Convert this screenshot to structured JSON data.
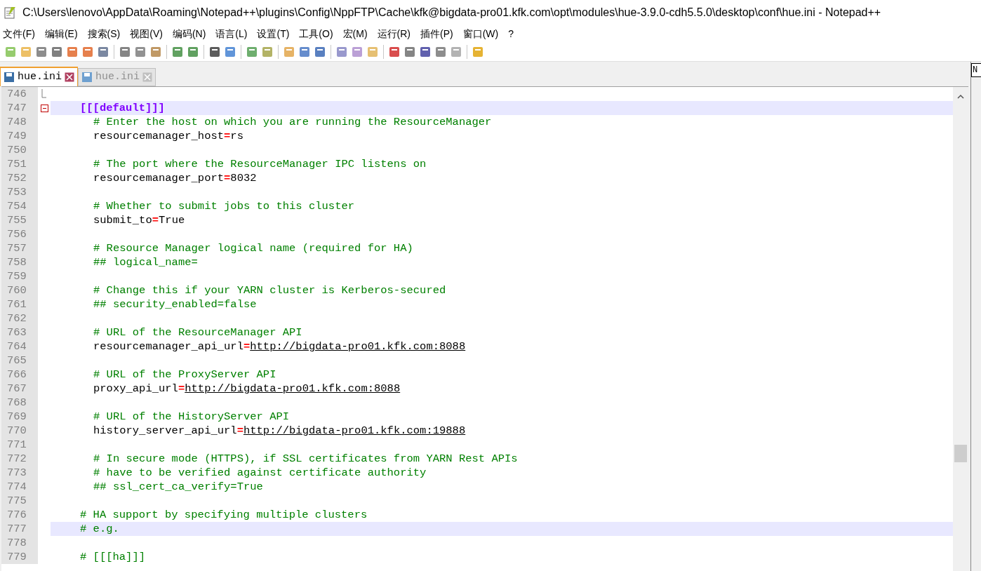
{
  "window": {
    "title": "C:\\Users\\lenovo\\AppData\\Roaming\\Notepad++\\plugins\\Config\\NppFTP\\Cache\\kfk@bigdata-pro01.kfk.com\\opt\\modules\\hue-3.9.0-cdh5.5.0\\desktop\\conf\\hue.ini - Notepad++"
  },
  "menu": [
    "文件(F)",
    "编辑(E)",
    "搜索(S)",
    "视图(V)",
    "编码(N)",
    "语言(L)",
    "设置(T)",
    "工具(O)",
    "宏(M)",
    "运行(R)",
    "插件(P)",
    "窗口(W)",
    "?"
  ],
  "tabs": [
    {
      "label": "hue.ini",
      "selected": true
    },
    {
      "label": "hue.ini",
      "selected": false
    }
  ],
  "side_panel": {
    "title": "N"
  },
  "editor": {
    "lines": [
      {
        "number": "746",
        "kind": "fold_end",
        "highlighted": false
      },
      {
        "number": "747",
        "kind": "fold_start",
        "nested": false,
        "highlighted": true,
        "parts": [
          {
            "kind": "section",
            "text": "[[[default]]]"
          }
        ]
      },
      {
        "number": "748",
        "kind": "text",
        "nested": true,
        "highlighted": false,
        "parts": [
          {
            "kind": "comment",
            "text": "# Enter the host on which you are running the ResourceManager"
          }
        ]
      },
      {
        "number": "749",
        "kind": "text",
        "nested": true,
        "highlighted": false,
        "parts": [
          {
            "kind": "key",
            "text": "resourcemanager_host"
          },
          {
            "kind": "op",
            "text": "="
          },
          {
            "kind": "value",
            "text": "rs"
          }
        ]
      },
      {
        "number": "750",
        "kind": "text",
        "highlighted": false
      },
      {
        "number": "751",
        "kind": "text",
        "nested": true,
        "highlighted": false,
        "parts": [
          {
            "kind": "comment",
            "text": "# The port where the ResourceManager IPC listens on"
          }
        ]
      },
      {
        "number": "752",
        "kind": "text",
        "nested": true,
        "highlighted": false,
        "parts": [
          {
            "kind": "key",
            "text": "resourcemanager_port"
          },
          {
            "kind": "op",
            "text": "="
          },
          {
            "kind": "value",
            "text": "8032"
          }
        ]
      },
      {
        "number": "753",
        "kind": "text",
        "highlighted": false
      },
      {
        "number": "754",
        "kind": "text",
        "nested": true,
        "highlighted": false,
        "parts": [
          {
            "kind": "comment",
            "text": "# Whether to submit jobs to this cluster"
          }
        ]
      },
      {
        "number": "755",
        "kind": "text",
        "nested": true,
        "highlighted": false,
        "parts": [
          {
            "kind": "key",
            "text": "submit_to"
          },
          {
            "kind": "op",
            "text": "="
          },
          {
            "kind": "value",
            "text": "True"
          }
        ]
      },
      {
        "number": "756",
        "kind": "text",
        "highlighted": false
      },
      {
        "number": "757",
        "kind": "text",
        "nested": true,
        "highlighted": false,
        "parts": [
          {
            "kind": "comment",
            "text": "# Resource Manager logical name (required for HA)"
          }
        ]
      },
      {
        "number": "758",
        "kind": "text",
        "nested": true,
        "highlighted": false,
        "parts": [
          {
            "kind": "comment",
            "text": "## logical_name="
          }
        ]
      },
      {
        "number": "759",
        "kind": "text",
        "highlighted": false
      },
      {
        "number": "760",
        "kind": "text",
        "nested": true,
        "highlighted": false,
        "parts": [
          {
            "kind": "comment",
            "text": "# Change this if your YARN cluster is Kerberos-secured"
          }
        ]
      },
      {
        "number": "761",
        "kind": "text",
        "nested": true,
        "highlighted": false,
        "parts": [
          {
            "kind": "comment",
            "text": "## security_enabled=false"
          }
        ]
      },
      {
        "number": "762",
        "kind": "text",
        "highlighted": false
      },
      {
        "number": "763",
        "kind": "text",
        "nested": true,
        "highlighted": false,
        "parts": [
          {
            "kind": "comment",
            "text": "# URL of the ResourceManager API"
          }
        ]
      },
      {
        "number": "764",
        "kind": "text",
        "nested": true,
        "highlighted": false,
        "parts": [
          {
            "kind": "key",
            "text": "resourcemanager_api_url"
          },
          {
            "kind": "op",
            "text": "="
          },
          {
            "kind": "url",
            "text": "http://bigdata-pro01.kfk.com:8088"
          }
        ]
      },
      {
        "number": "765",
        "kind": "text",
        "highlighted": false
      },
      {
        "number": "766",
        "kind": "text",
        "nested": true,
        "highlighted": false,
        "parts": [
          {
            "kind": "comment",
            "text": "# URL of the ProxyServer API"
          }
        ]
      },
      {
        "number": "767",
        "kind": "text",
        "nested": true,
        "highlighted": false,
        "parts": [
          {
            "kind": "key",
            "text": "proxy_api_url"
          },
          {
            "kind": "op",
            "text": "="
          },
          {
            "kind": "url",
            "text": "http://bigdata-pro01.kfk.com:8088"
          }
        ]
      },
      {
        "number": "768",
        "kind": "text",
        "highlighted": false
      },
      {
        "number": "769",
        "kind": "text",
        "nested": true,
        "highlighted": false,
        "parts": [
          {
            "kind": "comment",
            "text": "# URL of the HistoryServer API"
          }
        ]
      },
      {
        "number": "770",
        "kind": "text",
        "nested": true,
        "highlighted": false,
        "parts": [
          {
            "kind": "key",
            "text": "history_server_api_url"
          },
          {
            "kind": "op",
            "text": "="
          },
          {
            "kind": "url",
            "text": "http://bigdata-pro01.kfk.com:19888"
          }
        ]
      },
      {
        "number": "771",
        "kind": "text",
        "highlighted": false
      },
      {
        "number": "772",
        "kind": "text",
        "nested": true,
        "highlighted": false,
        "parts": [
          {
            "kind": "comment",
            "text": "# In secure mode (HTTPS), if SSL certificates from YARN Rest APIs"
          }
        ]
      },
      {
        "number": "773",
        "kind": "text",
        "nested": true,
        "highlighted": false,
        "parts": [
          {
            "kind": "comment",
            "text": "# have to be verified against certificate authority"
          }
        ]
      },
      {
        "number": "774",
        "kind": "text",
        "nested": true,
        "highlighted": false,
        "parts": [
          {
            "kind": "comment",
            "text": "## ssl_cert_ca_verify=True"
          }
        ]
      },
      {
        "number": "775",
        "kind": "text",
        "highlighted": false
      },
      {
        "number": "776",
        "kind": "text",
        "nested": false,
        "highlighted": false,
        "parts": [
          {
            "kind": "comment",
            "text": "# HA support by specifying multiple clusters"
          }
        ]
      },
      {
        "number": "777",
        "kind": "text",
        "nested": false,
        "highlighted": true,
        "parts": [
          {
            "kind": "comment",
            "text": "# e.g."
          }
        ]
      },
      {
        "number": "778",
        "kind": "text",
        "highlighted": false
      },
      {
        "number": "779",
        "kind": "text",
        "nested": false,
        "highlighted": false,
        "parts": [
          {
            "kind": "comment",
            "text": "# [[[ha]]]"
          }
        ]
      }
    ]
  }
}
